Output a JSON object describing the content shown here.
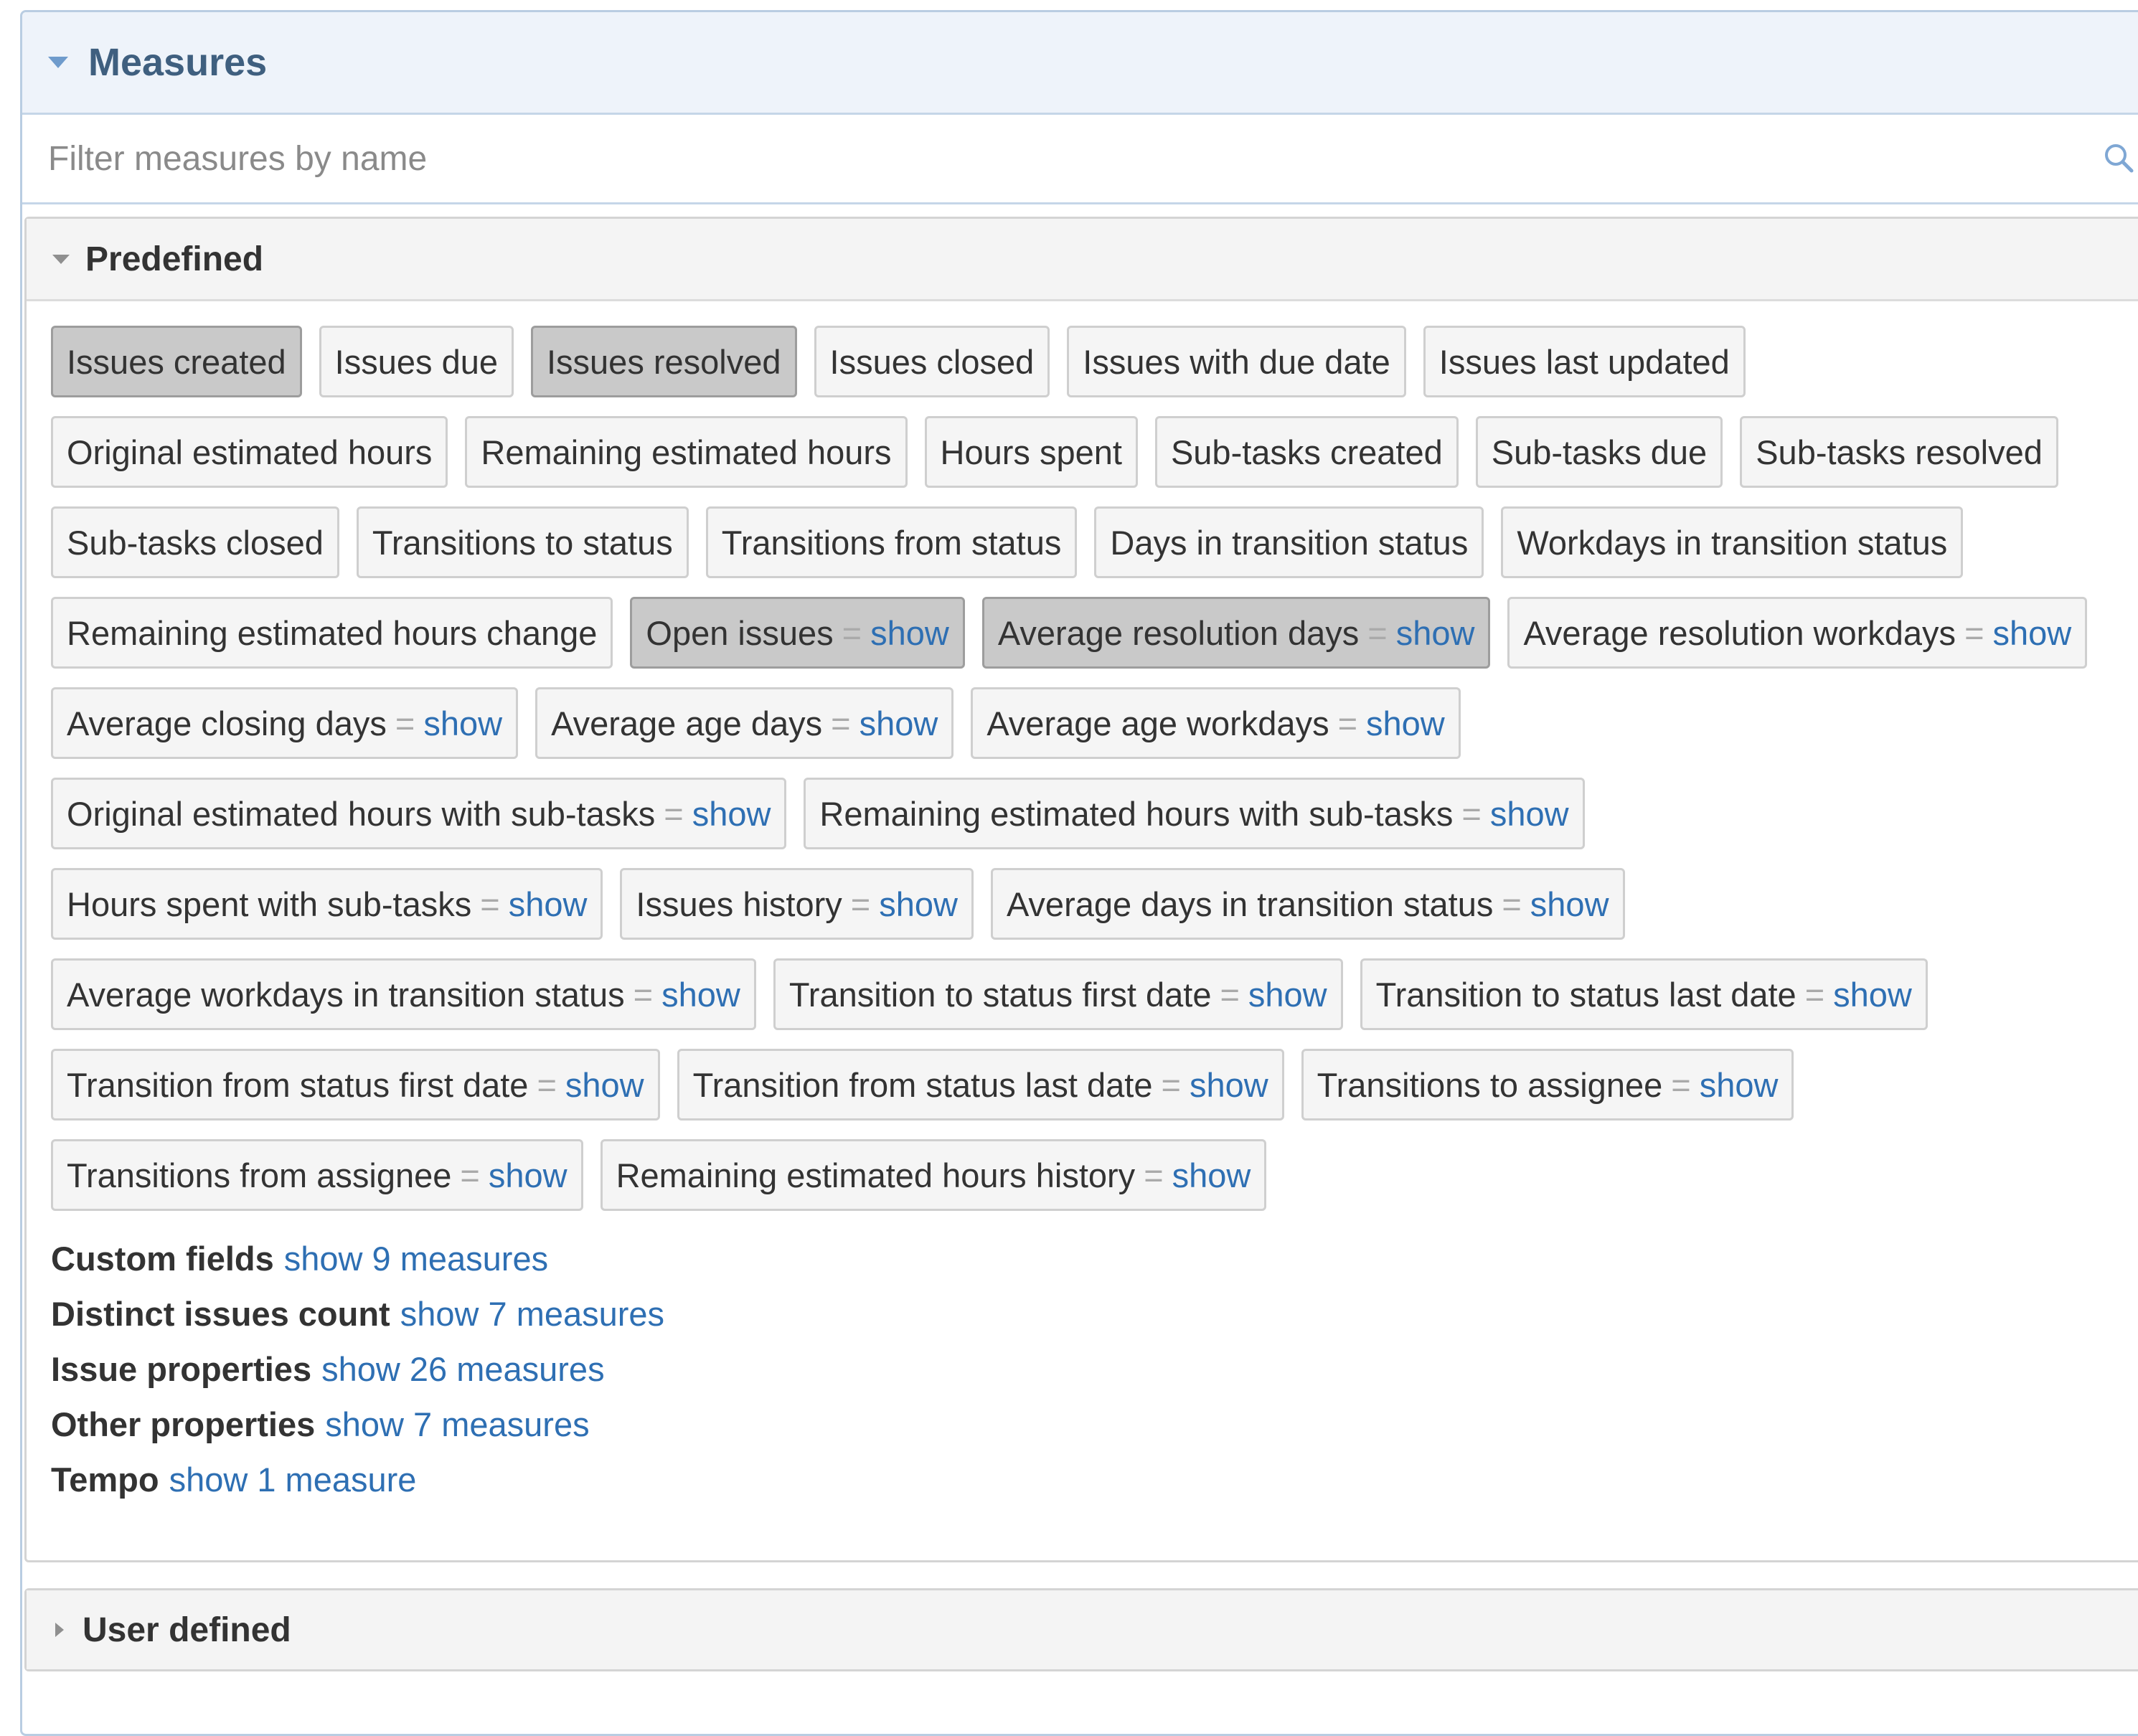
{
  "panel": {
    "title": "Measures",
    "filter_placeholder": "Filter measures by name"
  },
  "predefined": {
    "title": "Predefined",
    "measures": [
      {
        "label": "Issues created",
        "selected": true,
        "show_link": null
      },
      {
        "label": "Issues due",
        "selected": false,
        "show_link": null
      },
      {
        "label": "Issues resolved",
        "selected": true,
        "show_link": null
      },
      {
        "label": "Issues closed",
        "selected": false,
        "show_link": null
      },
      {
        "label": "Issues with due date",
        "selected": false,
        "show_link": null
      },
      {
        "label": "Issues last updated",
        "selected": false,
        "show_link": null
      },
      {
        "label": "Original estimated hours",
        "selected": false,
        "show_link": null
      },
      {
        "label": "Remaining estimated hours",
        "selected": false,
        "show_link": null
      },
      {
        "label": "Hours spent",
        "selected": false,
        "show_link": null
      },
      {
        "label": "Sub-tasks created",
        "selected": false,
        "show_link": null
      },
      {
        "label": "Sub-tasks due",
        "selected": false,
        "show_link": null
      },
      {
        "label": "Sub-tasks resolved",
        "selected": false,
        "show_link": null
      },
      {
        "label": "Sub-tasks closed",
        "selected": false,
        "show_link": null
      },
      {
        "label": "Transitions to status",
        "selected": false,
        "show_link": null
      },
      {
        "label": "Transitions from status",
        "selected": false,
        "show_link": null
      },
      {
        "label": "Days in transition status",
        "selected": false,
        "show_link": null
      },
      {
        "label": "Workdays in transition status",
        "selected": false,
        "show_link": null
      },
      {
        "label": "Remaining estimated hours change",
        "selected": false,
        "show_link": null
      },
      {
        "label": "Open issues",
        "selected": true,
        "show_link": "show"
      },
      {
        "label": "Average resolution days",
        "selected": true,
        "show_link": "show"
      },
      {
        "label": "Average resolution workdays",
        "selected": false,
        "show_link": "show"
      },
      {
        "label": "Average closing days",
        "selected": false,
        "show_link": "show"
      },
      {
        "label": "Average age days",
        "selected": false,
        "show_link": "show"
      },
      {
        "label": "Average age workdays",
        "selected": false,
        "show_link": "show"
      },
      {
        "label": "Original estimated hours with sub-tasks",
        "selected": false,
        "show_link": "show"
      },
      {
        "label": "Remaining estimated hours with sub-tasks",
        "selected": false,
        "show_link": "show"
      },
      {
        "label": "Hours spent with sub-tasks",
        "selected": false,
        "show_link": "show"
      },
      {
        "label": "Issues history",
        "selected": false,
        "show_link": "show"
      },
      {
        "label": "Average days in transition status",
        "selected": false,
        "show_link": "show"
      },
      {
        "label": "Average workdays in transition status",
        "selected": false,
        "show_link": "show"
      },
      {
        "label": "Transition to status first date",
        "selected": false,
        "show_link": "show"
      },
      {
        "label": "Transition to status last date",
        "selected": false,
        "show_link": "show"
      },
      {
        "label": "Transition from status first date",
        "selected": false,
        "show_link": "show"
      },
      {
        "label": "Transition from status last date",
        "selected": false,
        "show_link": "show"
      },
      {
        "label": "Transitions to assignee",
        "selected": false,
        "show_link": "show"
      },
      {
        "label": "Transitions from assignee",
        "selected": false,
        "show_link": "show"
      },
      {
        "label": "Remaining estimated hours history",
        "selected": false,
        "show_link": "show"
      }
    ],
    "groups": [
      {
        "name": "Custom fields",
        "link": "show 9 measures"
      },
      {
        "name": "Distinct issues count",
        "link": "show 7 measures"
      },
      {
        "name": "Issue properties",
        "link": "show 26 measures"
      },
      {
        "name": "Other properties",
        "link": "show 7 measures"
      },
      {
        "name": "Tempo",
        "link": "show 1 measure"
      }
    ]
  },
  "user_defined": {
    "title": "User defined"
  },
  "colors": {
    "accent_link": "#2e6fb3",
    "header_bg": "#eef3fa",
    "header_title": "#3f5f7f",
    "selected_chip": "#c9c9c9",
    "chip_bg": "#f5f5f5"
  },
  "icons": {
    "collapse_measures": "triangle-down-icon",
    "search": "search-icon",
    "collapse_predefined": "triangle-down-icon",
    "expand_user_defined": "triangle-right-icon"
  }
}
